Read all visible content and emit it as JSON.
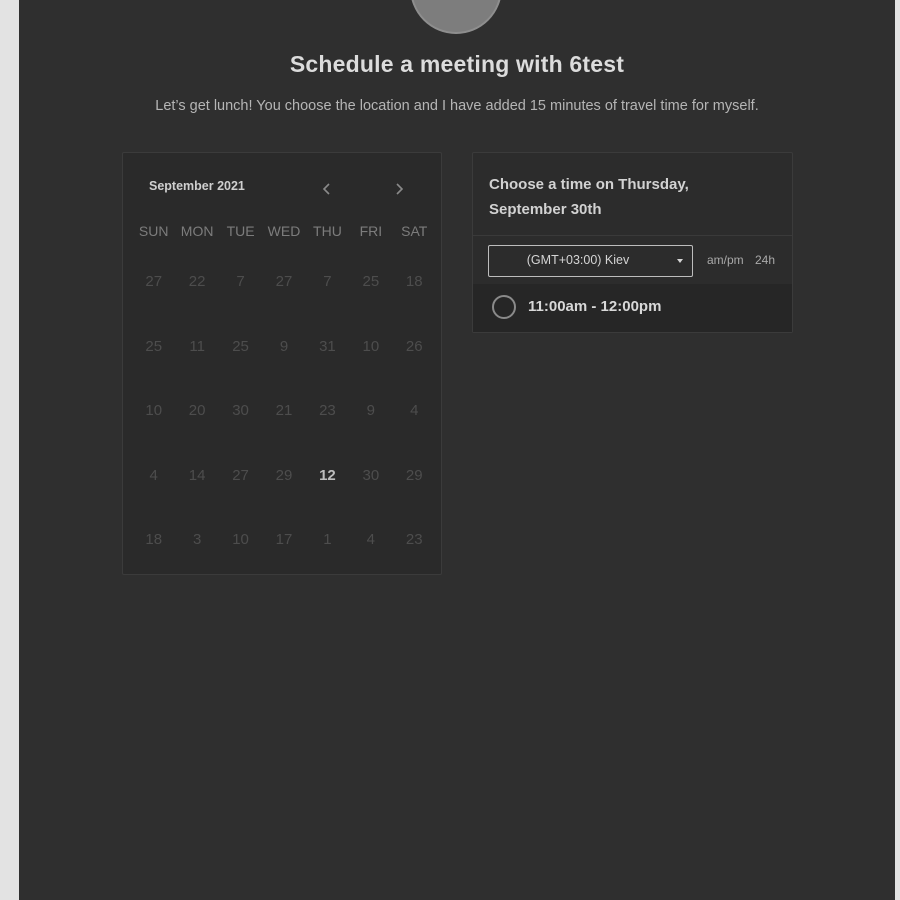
{
  "header": {
    "title": "Schedule a meeting with 6test",
    "subtitle": "Let’s get lunch! You choose the location and I have added 15 minutes of travel time for myself."
  },
  "calendar": {
    "month_label": "September 2021",
    "prev_icon": "chevron-left-icon",
    "next_icon": "chevron-right-icon",
    "weekdays": [
      "SUN",
      "MON",
      "TUE",
      "WED",
      "THU",
      "FRI",
      "SAT"
    ],
    "weeks": [
      [
        "27",
        "22",
        "7",
        "27",
        "7",
        "25",
        "18"
      ],
      [
        "25",
        "11",
        "25",
        "9",
        "31",
        "10",
        "26"
      ],
      [
        "10",
        "20",
        "30",
        "21",
        "23",
        "9",
        "4"
      ],
      [
        "4",
        "14",
        "27",
        "29",
        "12",
        "30",
        "29"
      ],
      [
        "18",
        "3",
        "10",
        "17",
        "1",
        "4",
        "23"
      ]
    ],
    "active_day": "12"
  },
  "time_panel": {
    "heading": "Choose a time on Thursday, September 30th",
    "timezone": "(GMT+03:00) Kiev",
    "format_ampm": "am/pm",
    "format_24h": "24h",
    "slots": [
      {
        "label": "11:00am - 12:00pm"
      }
    ]
  },
  "colors": {
    "background": "#2f2f2f",
    "panel": "#2a2a2a",
    "text": "#dcdcdc",
    "muted": "#4d4d4d"
  }
}
